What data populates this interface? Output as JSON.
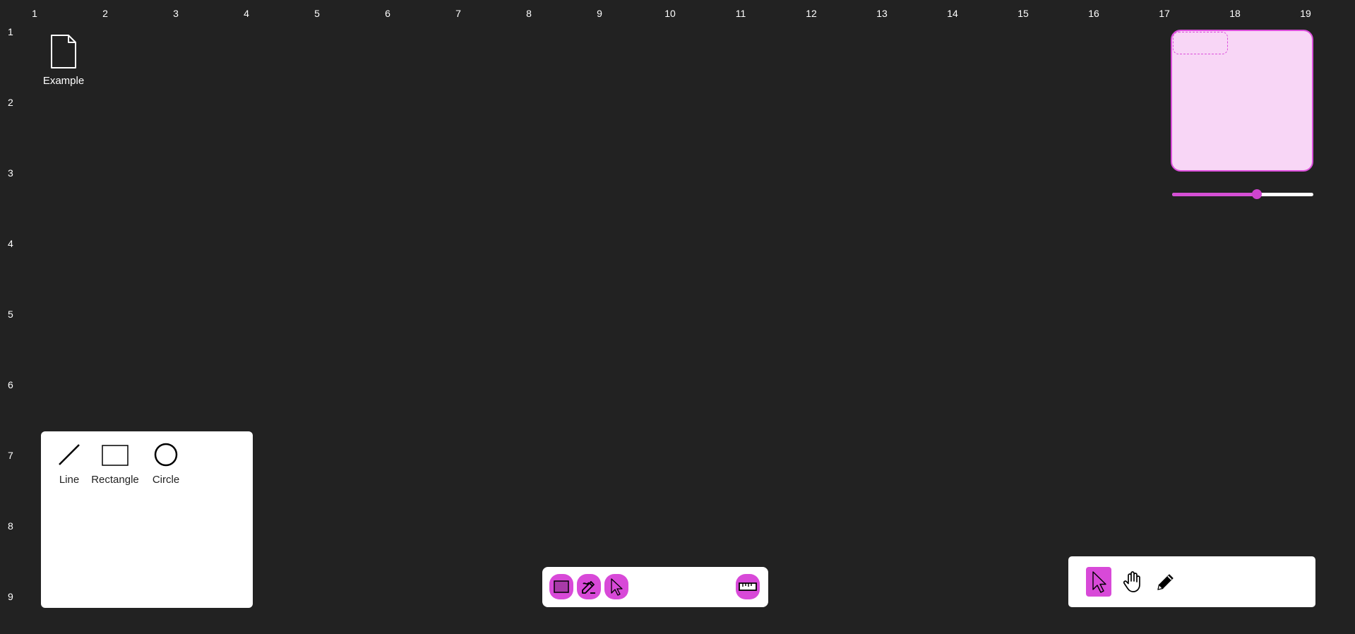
{
  "ruler": {
    "columns": [
      "1",
      "2",
      "3",
      "4",
      "5",
      "6",
      "7",
      "8",
      "9",
      "10",
      "11",
      "12",
      "13",
      "14",
      "15",
      "16",
      "17",
      "18",
      "19"
    ],
    "rows": [
      "1",
      "2",
      "3",
      "4",
      "5",
      "6",
      "7",
      "8",
      "9"
    ]
  },
  "canvas": {
    "file_item": {
      "icon": "file-icon",
      "label": "Example"
    }
  },
  "minimap": {
    "zoom_level": 0.6
  },
  "shape_panel": {
    "items": [
      {
        "icon": "line-icon",
        "label": "Line"
      },
      {
        "icon": "rectangle-icon",
        "label": "Rectangle"
      },
      {
        "icon": "circle-icon",
        "label": "Circle"
      }
    ]
  },
  "action_bar": {
    "buttons": [
      {
        "icon": "rectangle-fill-icon"
      },
      {
        "icon": "edit-icon"
      },
      {
        "icon": "cursor-icon"
      },
      {
        "icon": "ruler-icon"
      }
    ]
  },
  "tool_panel": {
    "tools": [
      {
        "icon": "pointer-icon",
        "active": true
      },
      {
        "icon": "hand-icon",
        "active": false
      },
      {
        "icon": "pencil-icon",
        "active": false
      }
    ]
  },
  "colors": {
    "background": "#222222",
    "accent": "#d849d8",
    "minimap_fill": "#f8d6f6",
    "panel": "#ffffff"
  }
}
